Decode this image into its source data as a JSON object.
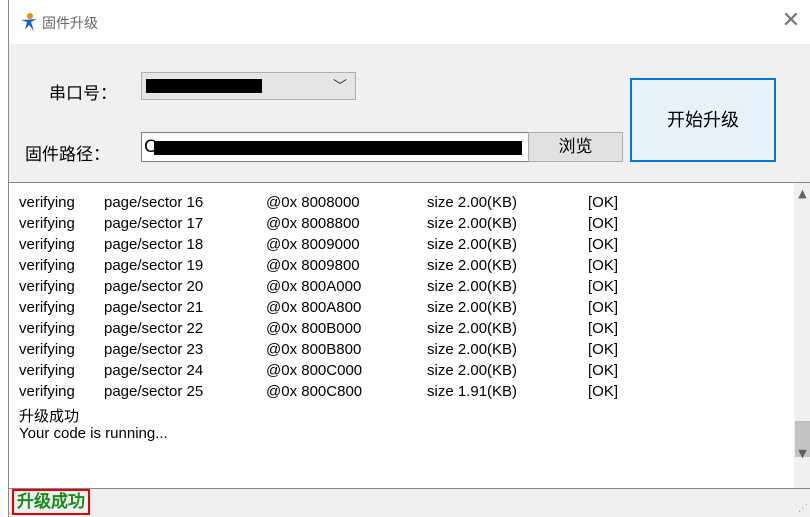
{
  "window": {
    "title": "固件升级",
    "icon": "person-logo-icon",
    "close_glyph": "✕"
  },
  "form": {
    "port_label": "串口号：",
    "port_value_redacted": true,
    "path_label": "固件路径：",
    "path_prefix": "C",
    "browse_label": "浏览",
    "start_label": "开始升级"
  },
  "log": {
    "rows": [
      {
        "action": "verifying",
        "sector": "page/sector 16",
        "addr": "@0x  8008000",
        "size": "size 2.00(KB)",
        "status": "[OK]"
      },
      {
        "action": "verifying",
        "sector": "page/sector 17",
        "addr": "@0x  8008800",
        "size": "size 2.00(KB)",
        "status": "[OK]"
      },
      {
        "action": "verifying",
        "sector": "page/sector 18",
        "addr": "@0x  8009000",
        "size": "size 2.00(KB)",
        "status": "[OK]"
      },
      {
        "action": "verifying",
        "sector": "page/sector 19",
        "addr": "@0x  8009800",
        "size": "size 2.00(KB)",
        "status": "[OK]"
      },
      {
        "action": "verifying",
        "sector": "page/sector 20",
        "addr": "@0x  800A000",
        "size": "size 2.00(KB)",
        "status": "[OK]"
      },
      {
        "action": "verifying",
        "sector": "page/sector 21",
        "addr": "@0x  800A800",
        "size": "size 2.00(KB)",
        "status": "[OK]"
      },
      {
        "action": "verifying",
        "sector": "page/sector 22",
        "addr": "@0x  800B000",
        "size": "size 2.00(KB)",
        "status": "[OK]"
      },
      {
        "action": "verifying",
        "sector": "page/sector 23",
        "addr": "@0x  800B800",
        "size": "size 2.00(KB)",
        "status": "[OK]"
      },
      {
        "action": "verifying",
        "sector": "page/sector 24",
        "addr": "@0x  800C000",
        "size": "size 2.00(KB)",
        "status": "[OK]"
      },
      {
        "action": "verifying",
        "sector": "page/sector 25",
        "addr": "@0x  800C800",
        "size": "size 1.91(KB)",
        "status": "[OK]"
      }
    ],
    "success_line": "升级成功",
    "running_line": "Your code is running..."
  },
  "status": {
    "text": "升级成功",
    "color": "#1a8a1a",
    "highlight_border": "#e00000"
  },
  "colors": {
    "accent": "#0078d7"
  }
}
